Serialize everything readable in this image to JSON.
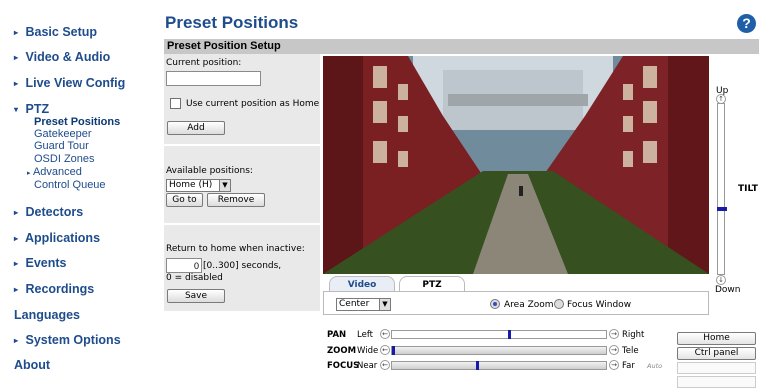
{
  "sidebar": {
    "items": [
      {
        "label": "Basic Setup"
      },
      {
        "label": "Video & Audio"
      },
      {
        "label": "Live View Config"
      },
      {
        "label": "PTZ"
      },
      {
        "label": "Detectors"
      },
      {
        "label": "Applications"
      },
      {
        "label": "Events"
      },
      {
        "label": "Recordings"
      },
      {
        "label": "Languages"
      },
      {
        "label": "System Options"
      },
      {
        "label": "About"
      }
    ],
    "ptz_sub": [
      {
        "label": "Preset Positions"
      },
      {
        "label": "Gatekeeper"
      },
      {
        "label": "Guard Tour"
      },
      {
        "label": "OSDI Zones"
      },
      {
        "label": "Advanced"
      },
      {
        "label": "Control Queue"
      }
    ]
  },
  "header": {
    "title": "Preset Positions",
    "help_icon": "help-icon",
    "help_glyph": "?"
  },
  "setup": {
    "section_title": "Preset Position Setup",
    "current_position_label": "Current position:",
    "current_position_value": "",
    "use_current_home_label": "Use current position as Home",
    "use_current_home_checked": false,
    "add_label": "Add",
    "available_label": "Available positions:",
    "available_selected": "Home (H)",
    "goto_label": "Go to",
    "remove_label": "Remove",
    "return_home_label": "Return to home when inactive:",
    "return_home_value": "0",
    "return_home_range": "[0..300] seconds,",
    "return_home_note": "0 = disabled",
    "save_label": "Save"
  },
  "tilt": {
    "up_label": "Up",
    "down_label": "Down",
    "title": "TILT",
    "level_fraction": 0.62
  },
  "tabs": [
    {
      "label": "Video"
    },
    {
      "label": "PTZ"
    }
  ],
  "ptz_controls": {
    "mode_selected": "Center",
    "area_zoom_label": "Area Zoom",
    "focus_window_label": "Focus Window",
    "area_zoom_selected": true
  },
  "sliders": {
    "pan": {
      "label": "PAN",
      "left": "Left",
      "right": "Right",
      "value": 0.55
    },
    "zoom": {
      "label": "ZOOM",
      "left": "Wide",
      "right": "Tele",
      "value": 0.0
    },
    "focus": {
      "label": "FOCUS",
      "left": "Near",
      "right": "Far",
      "extra": "Auto",
      "value": 0.4
    }
  },
  "right_buttons": {
    "home_label": "Home",
    "ctrl_panel_label": "Ctrl panel"
  },
  "colors": {
    "nav_text": "#1e4c8c",
    "accent": "#1f5fa8",
    "slider_thumb": "#1a1aaa",
    "section_bar": "#c7c7c7",
    "panel": "#e9e9e9"
  }
}
